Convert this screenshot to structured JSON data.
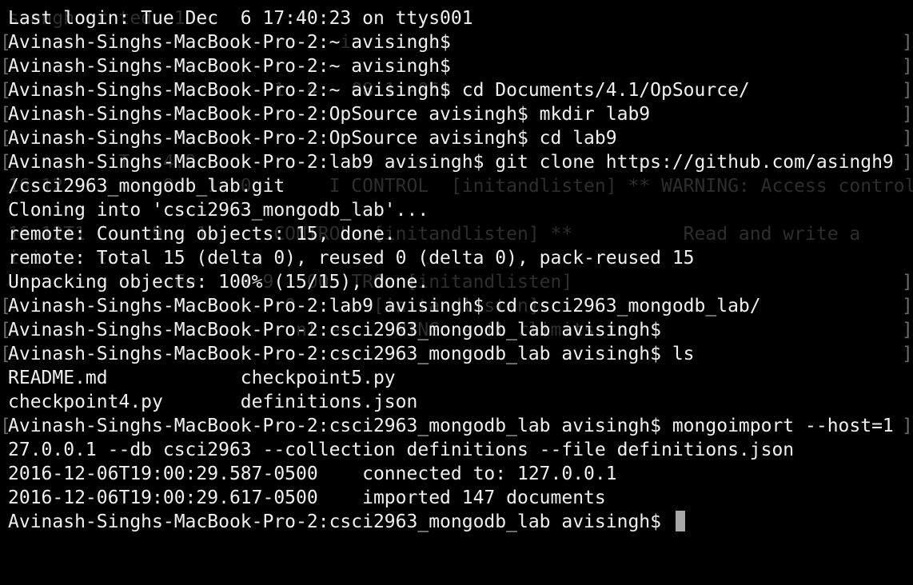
{
  "lines": [
    "Last login: Tue Dec  6 17:40:23 on ttys001",
    "Avinash-Singhs-MacBook-Pro-2:~ avisingh$",
    "Avinash-Singhs-MacBook-Pro-2:~ avisingh$",
    "Avinash-Singhs-MacBook-Pro-2:~ avisingh$ cd Documents/4.1/OpSource/",
    "Avinash-Singhs-MacBook-Pro-2:OpSource avisingh$ mkdir lab9",
    "Avinash-Singhs-MacBook-Pro-2:OpSource avisingh$ cd lab9",
    "Avinash-Singhs-MacBook-Pro-2:lab9 avisingh$ git clone https://github.com/asingh9",
    "/csci2963_mongodb_lab.git",
    "Cloning into 'csci2963_mongodb_lab'...",
    "remote: Counting objects: 15, done.",
    "remote: Total 15 (delta 0), reused 0 (delta 0), pack-reused 15",
    "Unpacking objects: 100% (15/15), done.",
    "Avinash-Singhs-MacBook-Pro-2:lab9 avisingh$ cd csci2963_mongodb_lab/",
    "Avinash-Singhs-MacBook-Pro-2:csci2963_mongodb_lab avisingh$",
    "Avinash-Singhs-MacBook-Pro-2:csci2963_mongodb_lab avisingh$ ls",
    "README.md            checkpoint5.py",
    "checkpoint4.py       definitions.json",
    "Avinash-Singhs-MacBook-Pro-2:csci2963_mongodb_lab avisingh$ mongoimport --host=1",
    "27.0.0.1 --db csci2963 --collection definitions --file definitions.json",
    "2016-12-06T19:00:29.587-0500    connected to: 127.0.0.1",
    "2016-12-06T19:00:29.617-0500    imported 147 documents",
    "Avinash-Singhs-MacBook-Pro-2:csci2963_mongodb_lab avisingh$ "
  ],
  "ghost_lines": [
    "s.angh gr ted  1    ",
    "                              i     ngo",
    "",
    "                        1  4   08 1 -050 ",
    "                               ",
    "",
    "          T   4.9            ",
    "16-12         9   1  0       I CONTROL  [initandlisten] ** WARNING: Access control i",
    "",
    "16-12T1      9   1      CONTROL  [initandlisten] **          Read and write a",
    "inic    t  ",
    "               Fe.   4 9   00  TRO  [initandlisten]",
    "                         0       [initandlisten]",
    "                          nl e     NING: soft rlimits to",
    "",
    "",
    "",
    "",
    "",
    "",
    "",
    ""
  ],
  "bracket_left_lines": [
    1,
    2,
    3,
    4,
    5,
    6,
    12,
    13,
    14,
    17
  ],
  "bracket_right_lines": [
    1,
    2,
    3,
    4,
    5,
    6,
    11,
    12,
    13,
    14,
    17
  ],
  "colors": {
    "background": "#000000",
    "text": "#f0f0f0",
    "ghost_text": "#2e2e2e",
    "cursor": "#a8a8a8",
    "bracket": "#6a6a6a"
  }
}
